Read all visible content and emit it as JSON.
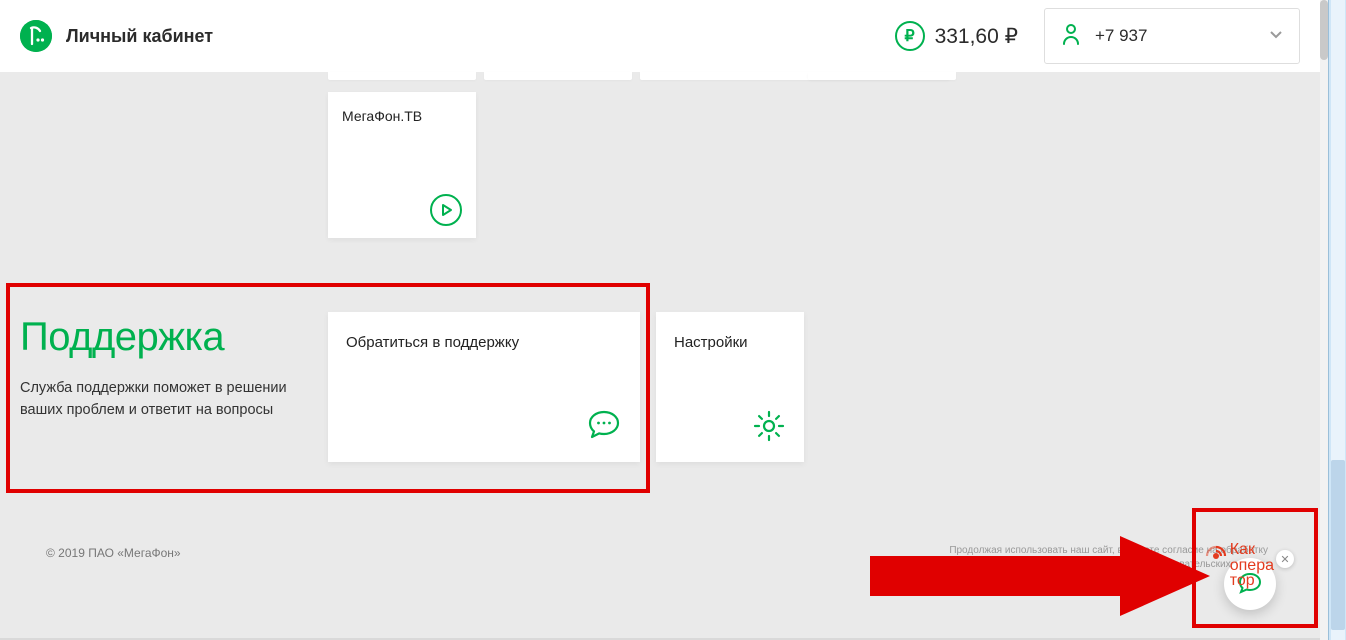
{
  "header": {
    "title": "Личный кабинет",
    "balance": "331,60 ₽",
    "ruble_glyph": "₽",
    "phone": "+7 937"
  },
  "cards": {
    "tv_title": "МегаФон.ТВ"
  },
  "support": {
    "heading": "Поддержка",
    "description": "Служба поддержки поможет в решении ваших проблем и ответит на вопросы",
    "contact_label": "Обратиться в поддержку",
    "settings_label": "Настройки"
  },
  "footer": {
    "copyright": "© 2019 ПАО «МегаФон»",
    "cookie_line1": "Продолжая использовать наш сайт, вы даете согласие на обработку",
    "cookie_line2": "пользовательских данных"
  },
  "watermark": {
    "line1": "Как",
    "line2": "опера",
    "line3": "тор"
  },
  "colors": {
    "accent": "#00b14f",
    "highlight": "#e00000"
  }
}
